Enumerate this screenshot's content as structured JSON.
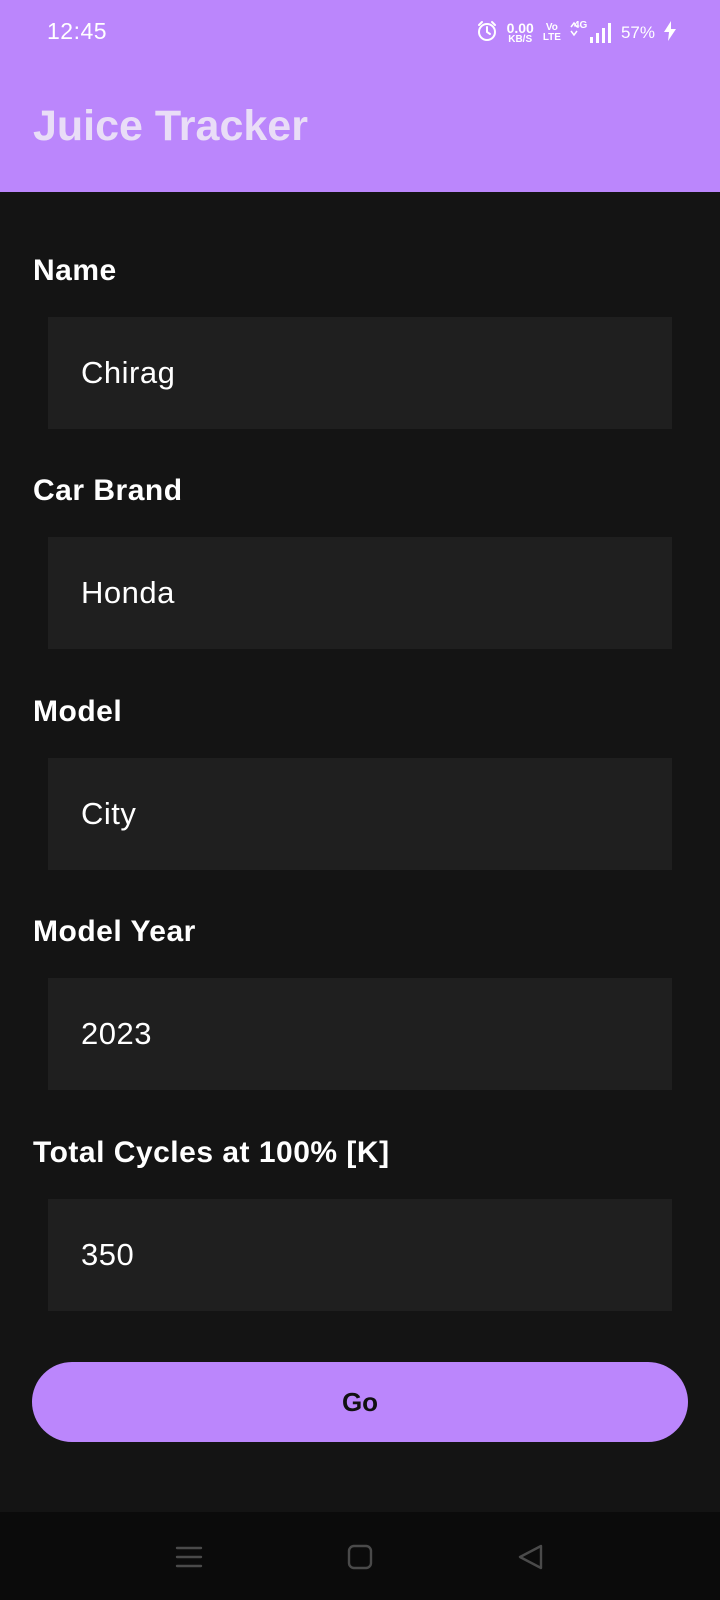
{
  "status_bar": {
    "time": "12:45",
    "net_speed_value": "0.00",
    "net_speed_unit": "KB/S",
    "volte_top": "Vo",
    "volte_bottom": "LTE",
    "network_type": "4G",
    "battery_percent": "57%",
    "icons": [
      "alarm-icon",
      "signal-icon",
      "charging-bolt-icon"
    ]
  },
  "app_bar": {
    "title": "Juice Tracker"
  },
  "form": {
    "fields": [
      {
        "label": "Name",
        "value": "Chirag"
      },
      {
        "label": "Car Brand",
        "value": "Honda"
      },
      {
        "label": "Model",
        "value": "City"
      },
      {
        "label": "Model Year",
        "value": "2023"
      },
      {
        "label": "Total Cycles at 100% [K]",
        "value": "350"
      }
    ],
    "submit_label": "Go"
  },
  "nav_bar": {
    "buttons": [
      "menu-icon",
      "home-icon",
      "back-icon"
    ]
  },
  "colors": {
    "accent": "#bb86fc",
    "background": "#141414",
    "field_background": "#1f1f1f",
    "nav_background": "#0b0b0b",
    "title_text": "#e9ddf7"
  }
}
